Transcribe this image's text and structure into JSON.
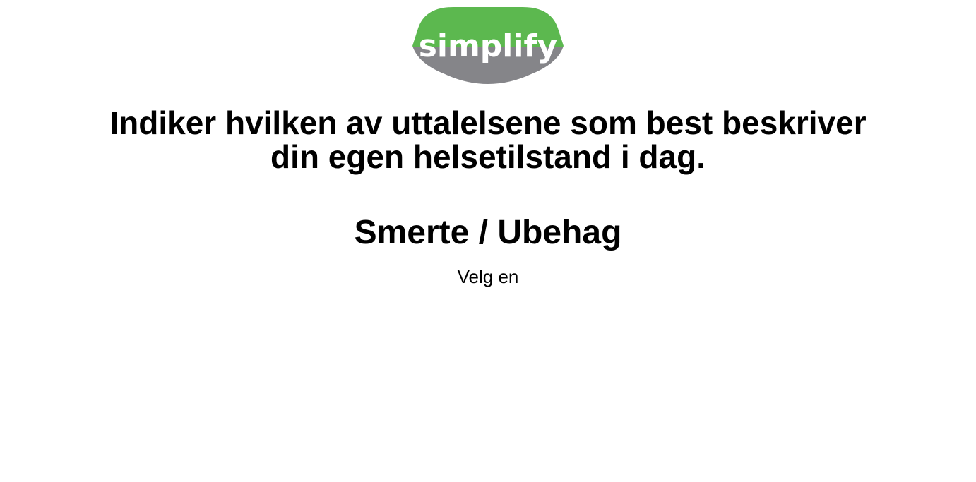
{
  "logo": {
    "text": "simplify",
    "colors": {
      "top": "#5cb84f",
      "bottom": "#858589",
      "text": "#ffffff"
    }
  },
  "question": {
    "line1": "Indiker hvilken av uttalelsene som best beskriver",
    "line2": "din egen helsetilstand i dag."
  },
  "dimension": {
    "title": "Smerte / Ubehag"
  },
  "instruction": {
    "text": "Velg en"
  }
}
